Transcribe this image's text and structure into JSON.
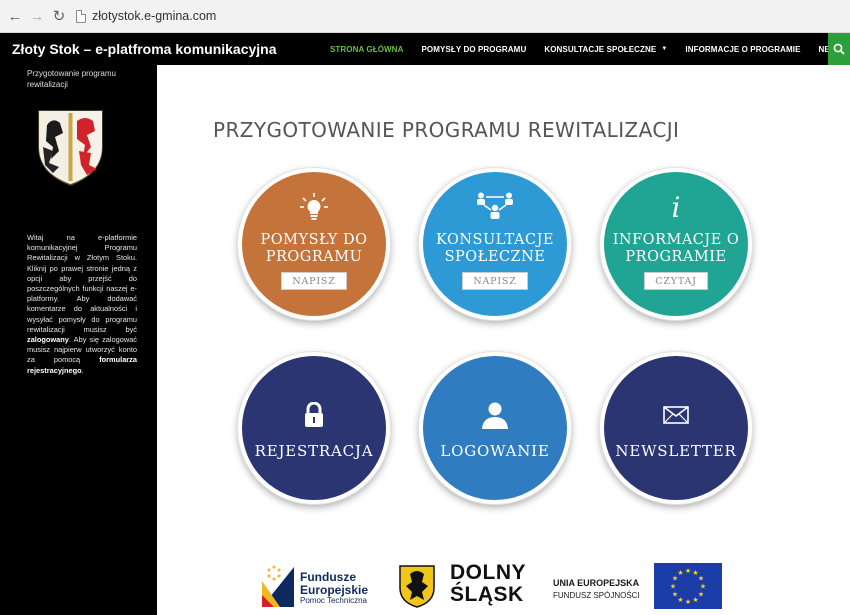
{
  "browser": {
    "url": "złotystok.e-gmina.com"
  },
  "header": {
    "site_title": "Złoty Stok – e-platfroma komunikacyjna",
    "menu": [
      {
        "label": "STRONA GŁÓWNA",
        "active": true
      },
      {
        "label": "POMYSŁY DO PROGRAMU",
        "active": false
      },
      {
        "label": "KONSULTACJE SPOŁECZNE",
        "active": false,
        "dropdown": true
      },
      {
        "label": "INFORMACJE O PROGRAMIE",
        "active": false
      },
      {
        "label": "NEWSLETTER",
        "active": false
      }
    ],
    "caret": "▼"
  },
  "sidebar": {
    "title": "Przygotowanie programu rewitalizacji",
    "intro_text": "Witaj na e-platformie komunikacyjnej Programu Rewitalizacji w Złotym Stoku. Kliknij po prawej stronie jedną z opcji aby przejść do poszczególnych funkcji naszej e-platformy. Aby dodawać komentarze do aktualności i wysyłać pomysły do programu rewitalizacji musisz być",
    "bold_logged_in": "zalogowany",
    "text_mid": ". Aby się zalogować musisz najpierw utworzyć konto za pomocą",
    "bold_form": "formularza rejestracyjnego",
    "text_end": "."
  },
  "main": {
    "title": "PRZYGOTOWANIE PROGRAMU REWITALIZACJI",
    "tiles": [
      {
        "line1": "POMYSŁY DO",
        "line2": "PROGRAMU",
        "button": "NAPISZ",
        "icon": "lightbulb-icon"
      },
      {
        "line1": "KONSULTACJE",
        "line2": "SPOŁECZNE",
        "button": "NAPISZ",
        "icon": "people-network-icon"
      },
      {
        "line1": "INFORMACJE O",
        "line2": "PROGRAMIE",
        "button": "CZYTAJ",
        "icon": "info-icon"
      },
      {
        "label": "REJESTRACJA",
        "icon": "lock-icon"
      },
      {
        "label": "LOGOWANIE",
        "icon": "user-icon"
      },
      {
        "label": "NEWSLETTER",
        "icon": "envelope-icon"
      }
    ],
    "info_glyph": "i"
  },
  "logos": {
    "fe_line1": "Fundusze",
    "fe_line2": "Europejskie",
    "fe_sub": "Pomoc Techniczna",
    "ds_line1": "DOLNY",
    "ds_line2": "ŚLĄSK",
    "ue_line1": "UNIA EUROPEJSKA",
    "ue_line2": "FUNDUSZ SPÓJNOŚCI"
  },
  "colors": {
    "orange": "#c4743a",
    "blue": "#2d9ad6",
    "teal": "#20a595",
    "navy": "#2a3572",
    "medblue": "#2f7cc0",
    "menu_active": "#6abf3f",
    "search": "#2e9e3a"
  }
}
